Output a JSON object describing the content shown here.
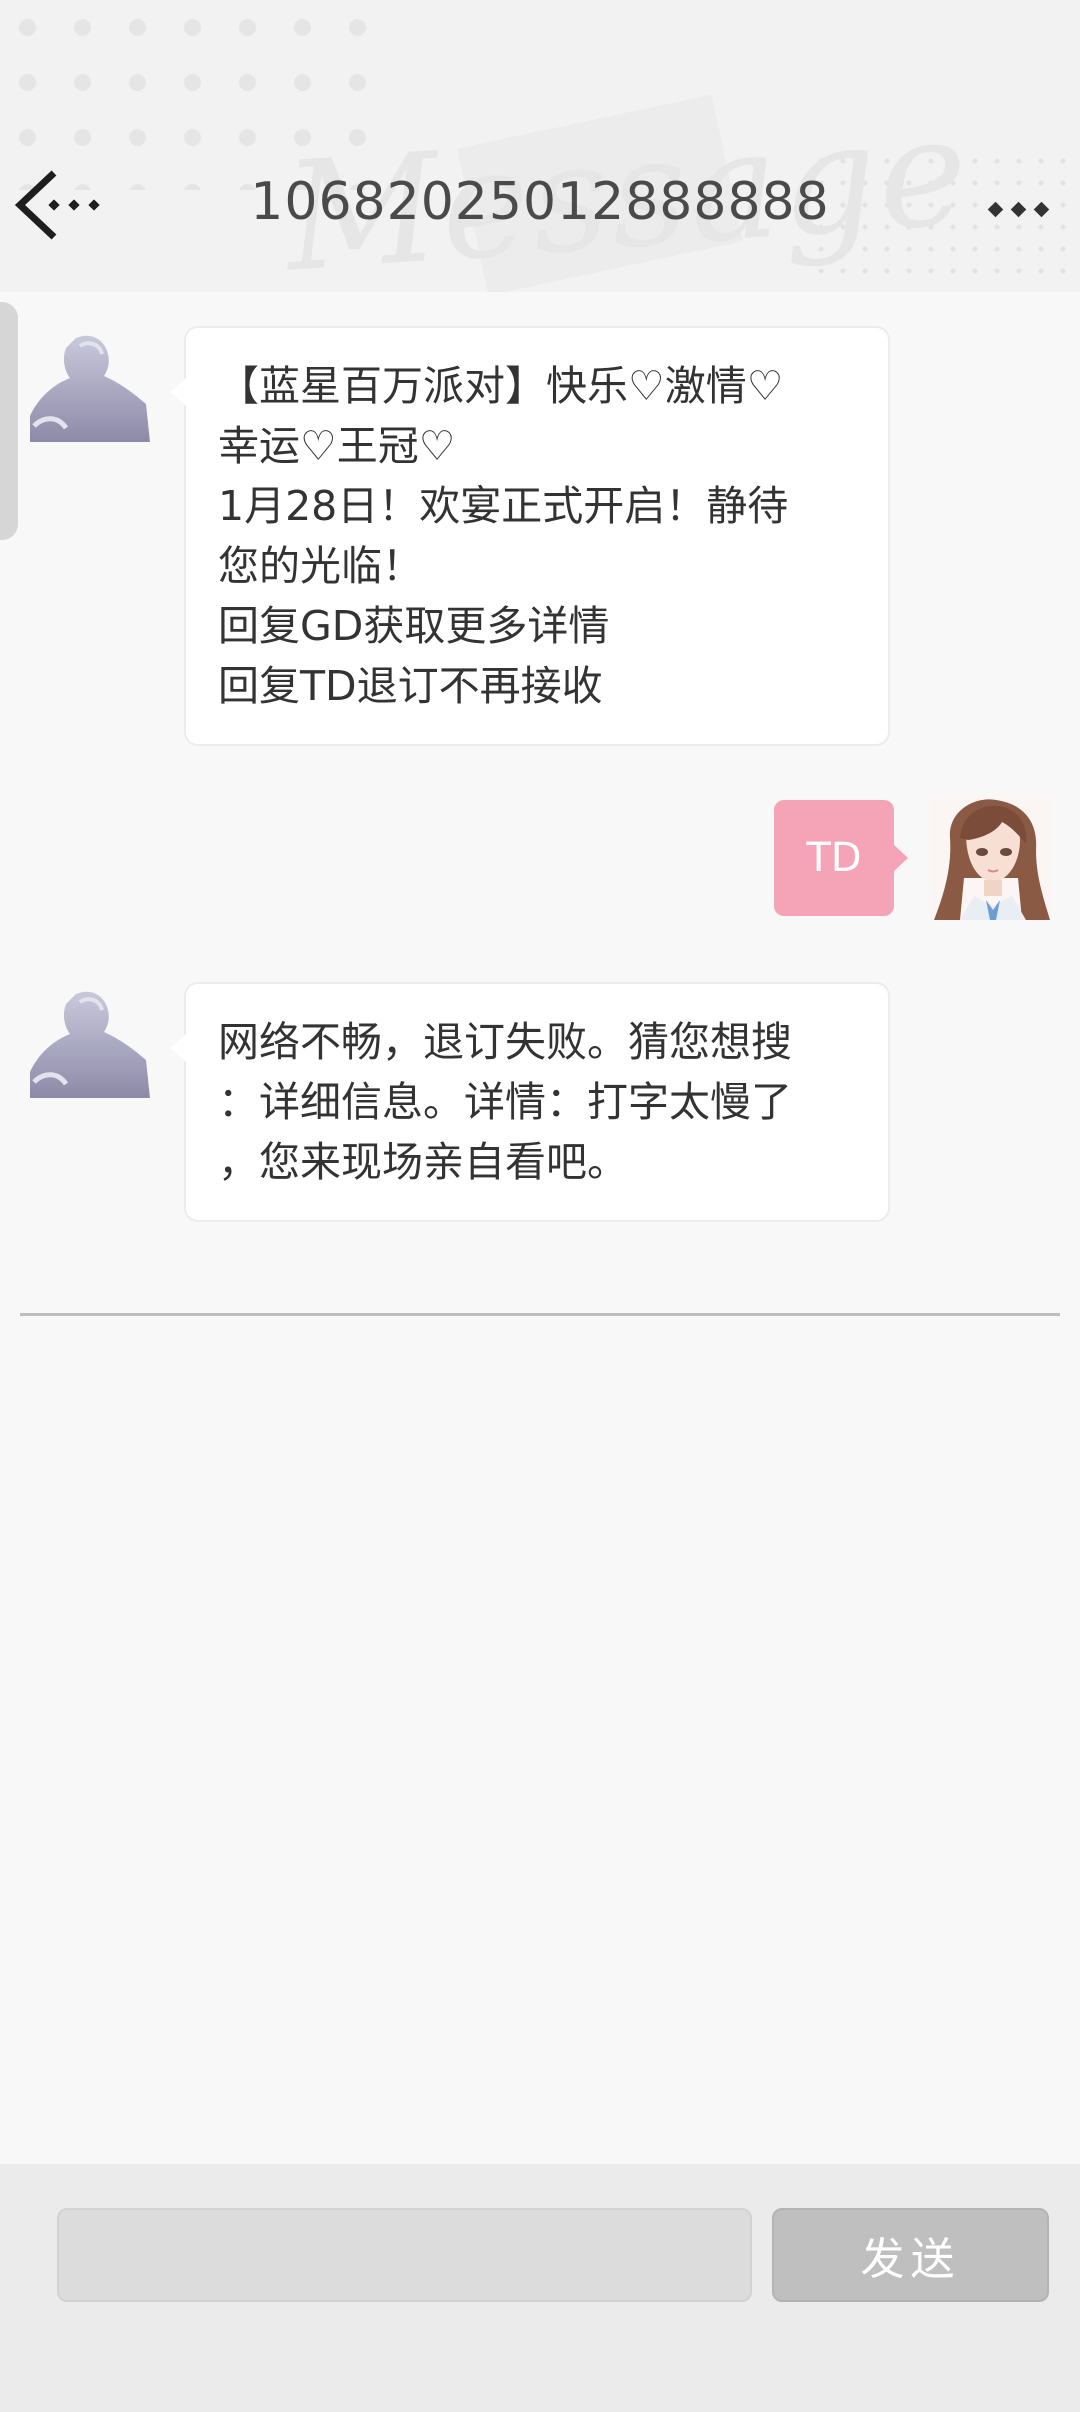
{
  "header": {
    "title": "10682025012888888",
    "decor_word": "Message",
    "back_icon": "back-arrow-icon",
    "more_icon": "more-dots-icon"
  },
  "messages": [
    {
      "direction": "incoming",
      "text": "【蓝星百万派对】快乐♡激情♡\n幸运♡王冠♡\n1月28日！欢宴正式开启！静待\n您的光临！\n回复GD获取更多详情\n回复TD退订不再接收"
    },
    {
      "direction": "outgoing",
      "text": "TD",
      "bubble_color": "#f5a3b7"
    },
    {
      "direction": "incoming",
      "text": "网络不畅，退订失败。猜您想搜\n：详细信息。详情：打字太慢了\n，您来现场亲自看吧。"
    }
  ],
  "input_bar": {
    "placeholder": "",
    "value": "",
    "send_label": "发送"
  }
}
